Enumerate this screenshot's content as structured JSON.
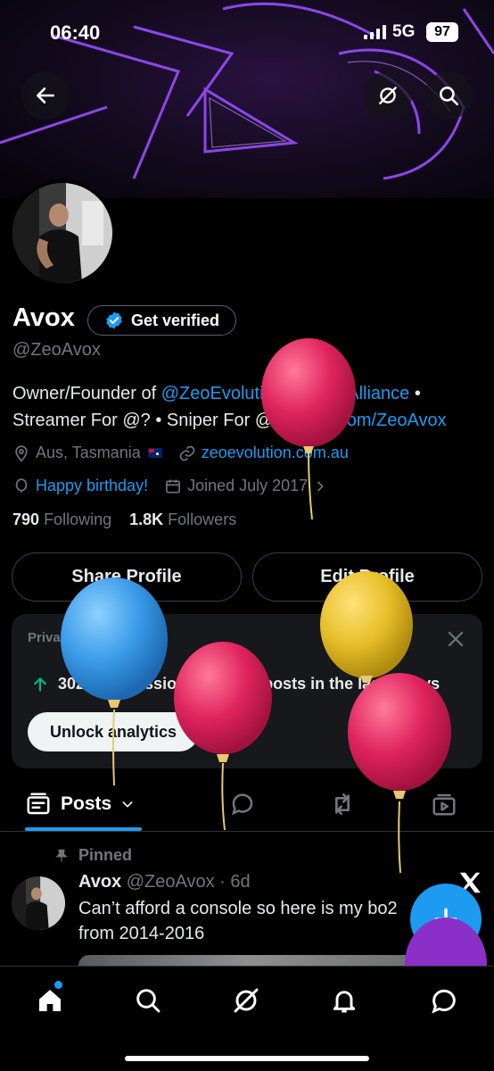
{
  "status_bar": {
    "time": "06:40",
    "network": "5G",
    "battery": "97"
  },
  "profile": {
    "name": "Avox",
    "verify_label": "Get verified",
    "handle": "@ZeoAvox",
    "bio": {
      "part1": "Owner/Founder of ",
      "link1": "@ZeoEvolution",
      "sep": " / ",
      "link2": "@ZeoAlliance",
      "part2": " • Streamer For @? • Sniper For @? • ",
      "link3": "Kick.com/ZeoAvox"
    },
    "location": "Aus, Tasmania",
    "website": "zeoevolution.com.au",
    "birthday": "Happy birthday!",
    "joined": "Joined July 2017",
    "following_count": "790",
    "following_label": "Following",
    "followers_count": "1.8K",
    "followers_label": "Followers"
  },
  "actions": {
    "share": "Share Profile",
    "edit": "Edit Profile"
  },
  "analytics": {
    "private_label": "Private to you",
    "impressions": "302K impressions on your posts in the last 7 days",
    "unlock_label": "Unlock analytics"
  },
  "tabs": {
    "posts_label": "Posts"
  },
  "post": {
    "pinned_label": "Pinned",
    "author": "Avox",
    "handle_time": "@ZeoAvox · 6d",
    "text": "Can’t afford a console so here is my bo2 from 2014-2016"
  },
  "colors": {
    "accent": "#1d9bf0",
    "background": "#000000",
    "banner_neon": "#8a3cff"
  },
  "icons": [
    "back-arrow-icon",
    "grok-icon",
    "search-icon",
    "verified-badge-icon",
    "location-icon",
    "link-icon",
    "balloon-icon",
    "calendar-icon",
    "chevron-right-icon",
    "close-icon",
    "up-arrow-icon",
    "posts-icon",
    "chevron-down-icon",
    "reply-icon",
    "repost-icon",
    "media-icon",
    "pin-icon",
    "x-logo-icon",
    "plus-icon",
    "home-icon",
    "grok-icon",
    "bell-icon",
    "messages-icon"
  ]
}
